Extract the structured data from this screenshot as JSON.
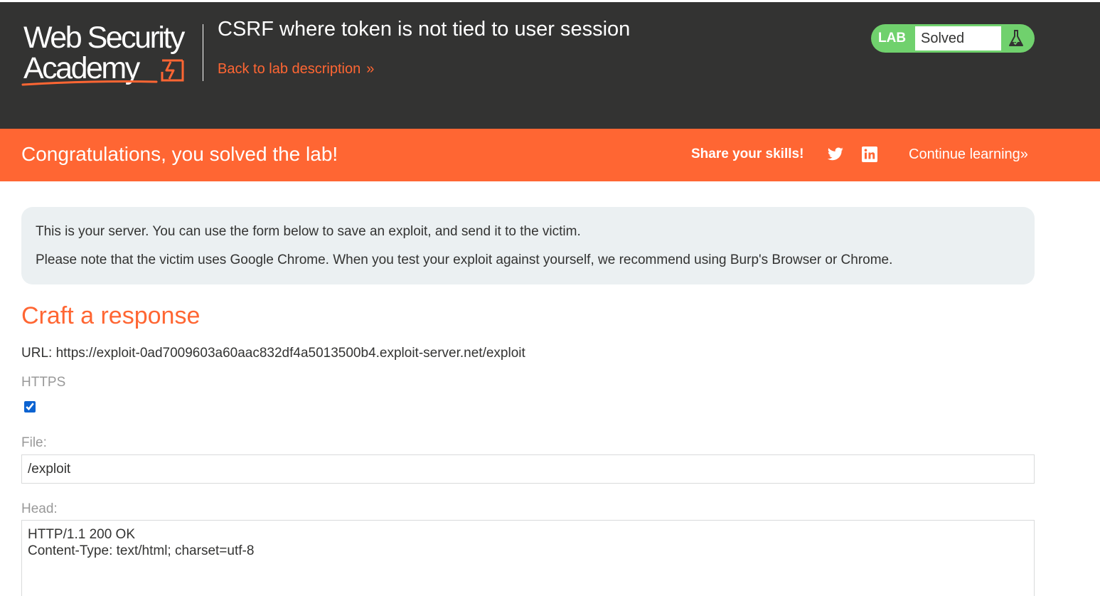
{
  "header": {
    "logo_line1": "Web Security",
    "logo_line2": "Academy",
    "lab_title": "CSRF where token is not tied to user session",
    "back_link": "Back to lab description",
    "back_chevron": "»",
    "lab_badge": "LAB",
    "lab_status": "Solved",
    "status_icon": "flask-icon"
  },
  "banner": {
    "congrats": "Congratulations, you solved the lab!",
    "share": "Share your skills!",
    "share_icons": [
      "twitter-icon",
      "linkedin-icon"
    ],
    "continue": "Continue learning",
    "continue_chevron": "»"
  },
  "info": {
    "line1": "This is your server. You can use the form below to save an exploit, and send it to the victim.",
    "line2": "Please note that the victim uses Google Chrome. When you test your exploit against yourself, we recommend using Burp's Browser or Chrome."
  },
  "form": {
    "title": "Craft a response",
    "url": "URL: https://exploit-0ad7009603a60aac832df4a5013500b4.exploit-server.net/exploit",
    "https_label": "HTTPS",
    "https_checked": true,
    "file_label": "File:",
    "file_value": "/exploit",
    "head_label": "Head:",
    "head_value": "HTTP/1.1 200 OK\nContent-Type: text/html; charset=utf-8"
  },
  "colors": {
    "header_bg": "#333332",
    "accent": "#ff6633",
    "solved_green": "#70d16d",
    "info_bg": "#ebf0f2"
  }
}
